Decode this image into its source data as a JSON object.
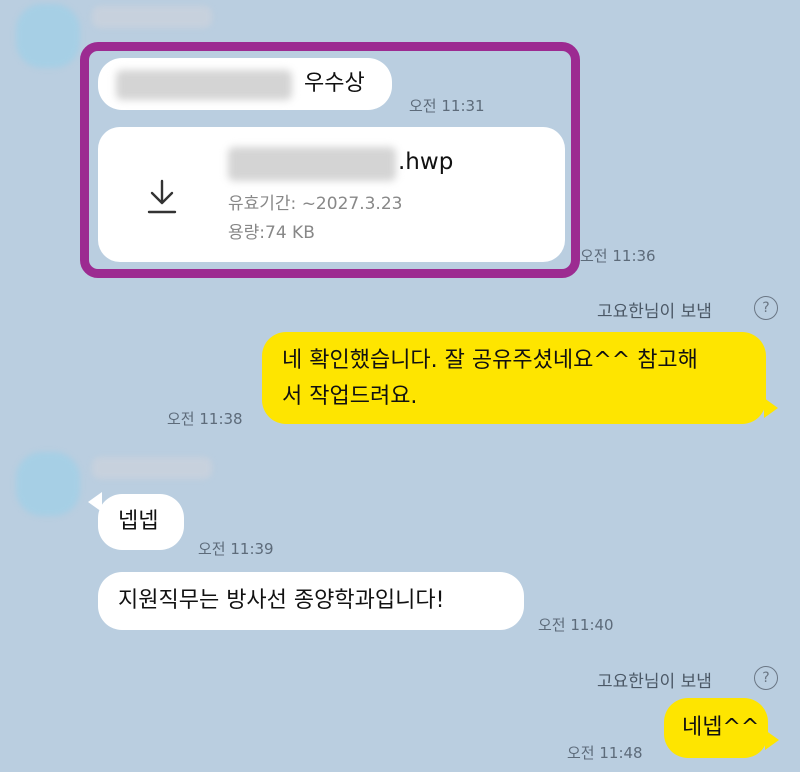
{
  "messages": [
    {
      "id": "m1",
      "text_suffix": "우수상",
      "time": "오전 11:31"
    },
    {
      "id": "m2",
      "file_ext": ".hwp",
      "validity": "유효기간: ~2027.3.23",
      "size": "용량:74 KB",
      "time": "오전 11:36"
    },
    {
      "id": "m3",
      "sender_note": "고요한님이 보냄",
      "text": "네 확인했습니다. 잘 공유주셨네요^^ 참고해서 작업드려요.",
      "line1": "네 확인했습니다. 잘 공유주셨네요^^ 참고해",
      "line2": "서 작업드려요.",
      "time": "오전 11:38"
    },
    {
      "id": "m4",
      "text": "넵넵",
      "time": "오전 11:39"
    },
    {
      "id": "m5",
      "text": "지원직무는 방사선 종양학과입니다!",
      "time": "오전 11:40"
    },
    {
      "id": "m6",
      "sender_note": "고요한님이 보냄",
      "text": "네넵^^",
      "time": "오전 11:48"
    }
  ],
  "icons": {
    "help": "?",
    "download": "download-icon"
  },
  "colors": {
    "background": "#bacee0",
    "my_bubble": "#fee500",
    "their_bubble": "#ffffff",
    "highlight": "#9c2b91"
  }
}
